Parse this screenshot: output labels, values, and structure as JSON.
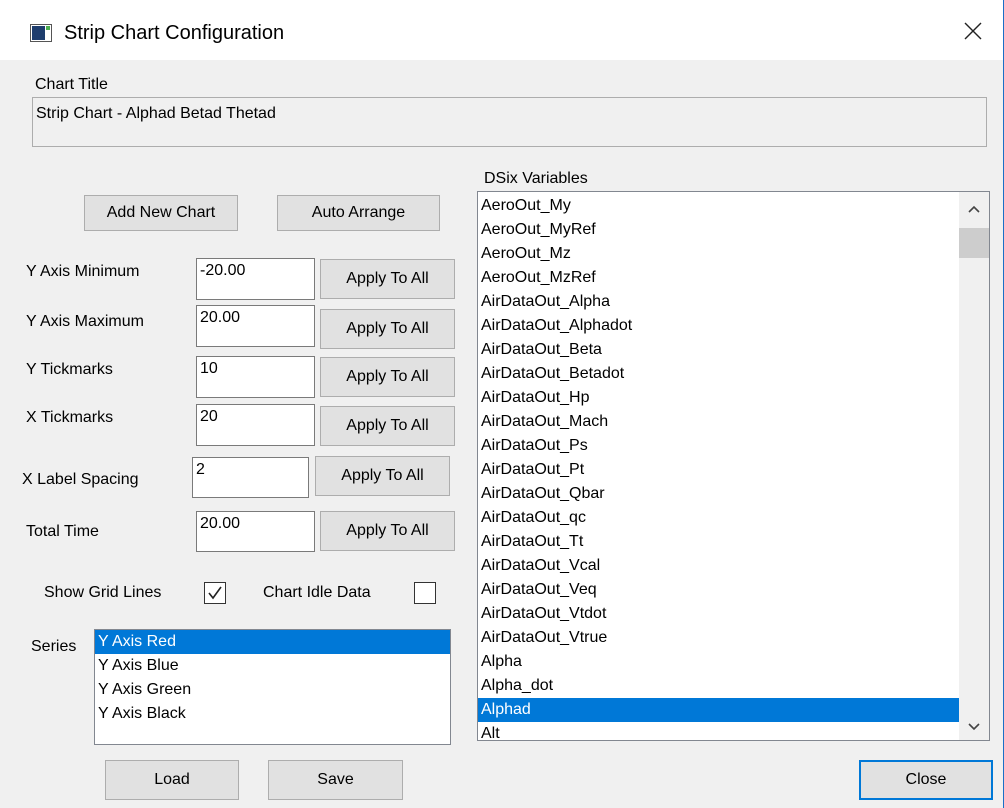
{
  "window": {
    "title": "Strip Chart Configuration"
  },
  "chart_title": {
    "label": "Chart Title",
    "value": "Strip Chart - Alphad Betad Thetad"
  },
  "buttons": {
    "add_new_chart": "Add New Chart",
    "auto_arrange": "Auto Arrange",
    "apply_to_all": "Apply To All",
    "load": "Load",
    "save": "Save",
    "close": "Close"
  },
  "fields": {
    "y_axis_min": {
      "label": "Y Axis Minimum",
      "value": "-20.00"
    },
    "y_axis_max": {
      "label": "Y Axis Maximum",
      "value": "20.00"
    },
    "y_tickmarks": {
      "label": "Y Tickmarks",
      "value": "10"
    },
    "x_tickmarks": {
      "label": "X Tickmarks",
      "value": "20"
    },
    "x_label_spacing": {
      "label": "X Label Spacing",
      "value": "2"
    },
    "total_time": {
      "label": "Total Time",
      "value": "20.00"
    }
  },
  "options": {
    "show_grid_lines": {
      "label": "Show Grid Lines",
      "checked": true
    },
    "chart_idle_data": {
      "label": "Chart Idle Data",
      "checked": false
    }
  },
  "series": {
    "label": "Series",
    "items": [
      "Y Axis Red",
      "Y Axis Blue",
      "Y Axis Green",
      "Y Axis Black"
    ],
    "selected_index": 0
  },
  "variables": {
    "label": "DSix Variables",
    "items": [
      "AeroOut_My",
      "AeroOut_MyRef",
      "AeroOut_Mz",
      "AeroOut_MzRef",
      "AirDataOut_Alpha",
      "AirDataOut_Alphadot",
      "AirDataOut_Beta",
      "AirDataOut_Betadot",
      "AirDataOut_Hp",
      "AirDataOut_Mach",
      "AirDataOut_Ps",
      "AirDataOut_Pt",
      "AirDataOut_Qbar",
      "AirDataOut_qc",
      "AirDataOut_Tt",
      "AirDataOut_Vcal",
      "AirDataOut_Veq",
      "AirDataOut_Vtdot",
      "AirDataOut_Vtrue",
      "Alpha",
      "Alpha_dot",
      "Alphad",
      "Alt"
    ],
    "selected_index": 21
  },
  "icons": {
    "app": "window-icon",
    "close": "close-icon",
    "checkmark": "checkmark-icon",
    "scroll_up": "chevron-up-icon",
    "scroll_down": "chevron-down-icon"
  },
  "colors": {
    "selection": "#0078d7",
    "window_bg": "#f0f0f0",
    "button_face": "#e1e1e1"
  }
}
